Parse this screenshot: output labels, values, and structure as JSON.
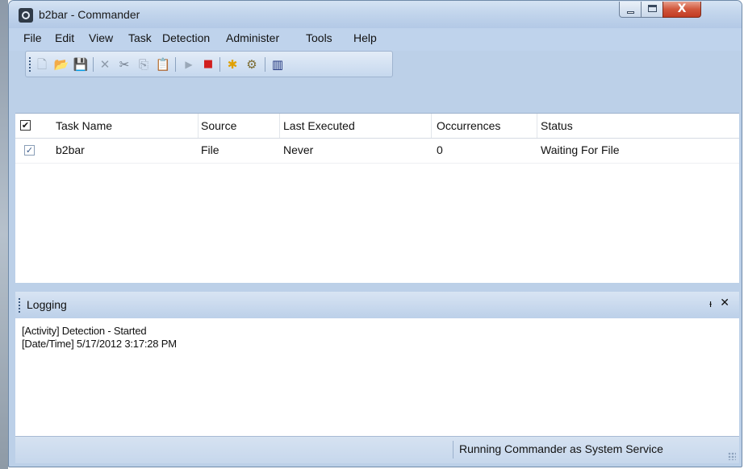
{
  "window": {
    "title": "b2bar - Commander"
  },
  "window_controls": {
    "minimize": "—",
    "maximize": "□",
    "close": "X"
  },
  "menu": [
    "File",
    "Edit",
    "View",
    "Task",
    "Detection",
    "Administer",
    "Tools",
    "Help"
  ],
  "toolbar": {
    "icons": [
      "new-icon",
      "open-icon",
      "save-icon",
      "delete-icon",
      "cut-icon",
      "copy-icon",
      "paste-icon",
      "run-icon",
      "stop-icon",
      "detect-icon",
      "properties-icon",
      "barcode-icon"
    ],
    "glyphs": {
      "new": "🗋",
      "open": "📂",
      "save": "💾",
      "delete": "✕",
      "cut": "✂",
      "copy": "⎘",
      "paste": "📋",
      "run": "▶",
      "stop": "■",
      "detect": "✱",
      "properties": "⚙",
      "barcode": "▥"
    }
  },
  "tasks": {
    "columns": [
      "Task Name",
      "Source",
      "Last Executed",
      "Occurrences",
      "Status"
    ],
    "header_check": "✔",
    "rows": [
      {
        "checked": "✓",
        "name": "b2bar",
        "source": "File",
        "last_executed": "Never",
        "occurrences": "0",
        "status": "Waiting For File"
      }
    ]
  },
  "logging": {
    "title": "Logging",
    "pin": "ᵼ",
    "close": "✕",
    "lines": [
      "[Activity] Detection - Started",
      "[Date/Time] 5/17/2012 3:17:28 PM"
    ]
  },
  "status": {
    "text": "Running Commander as System Service"
  },
  "colors": {
    "chrome": "#bfd3ec",
    "stop_icon": "#d11f1f",
    "close_button": "#c23b22"
  }
}
